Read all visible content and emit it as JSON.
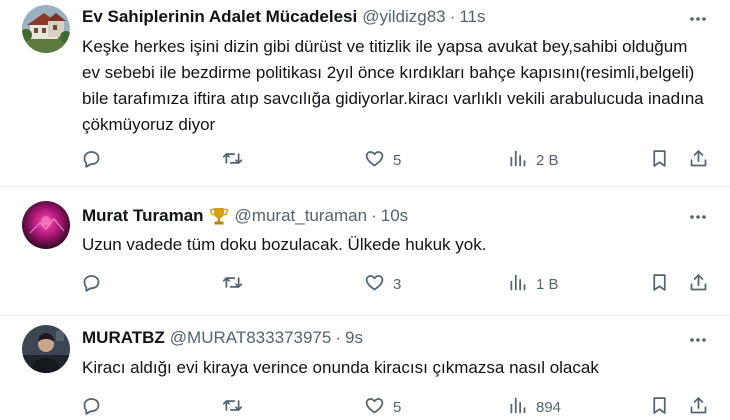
{
  "tweets": [
    {
      "name": "Ev Sahiplerinin Adalet Mücadelesi",
      "handle": "@yildizg83",
      "separator": "·",
      "time": "11s",
      "badge": "",
      "text": "Keşke herkes işini dizin gibi dürüst ve titizlik ile yapsa avukat bey,sahibi olduğum ev sebebi ile bezdirme politikası 2yıl önce kırdıkları bahçe kapısını(resimli,belgeli) bile tarafımıza iftira atıp savcılığa gidiyorlar.kiracı varlıklı vekili arabulucuda inadına çökmüyoruz diyor",
      "replies": "",
      "retweets": "",
      "likes": "5",
      "views": "2 B"
    },
    {
      "name": "Murat Turaman",
      "handle": "@murat_turaman",
      "separator": "·",
      "time": "10s",
      "badge": "trophy-icon",
      "text": "Uzun vadede tüm doku bozulacak. Ülkede hukuk yok.",
      "replies": "",
      "retweets": "",
      "likes": "3",
      "views": "1 B"
    },
    {
      "name": "MURATBZ",
      "handle": "@MURAT833373975",
      "separator": "·",
      "time": "9s",
      "badge": "",
      "text": "Kiracı aldığı evi kiraya verince onunda kiracısı çıkmazsa nasıl olacak",
      "replies": "",
      "retweets": "",
      "likes": "5",
      "views": "894"
    }
  ],
  "icons": {
    "reply": "reply-icon",
    "retweet": "retweet-icon",
    "like": "heart-icon",
    "views": "views-icon",
    "bookmark": "bookmark-icon",
    "share": "share-icon",
    "more": "more-icon"
  },
  "colors": {
    "text": "#0f1419",
    "secondary": "#536471",
    "divider": "#eff3f4",
    "trophy": "#d4a017"
  }
}
